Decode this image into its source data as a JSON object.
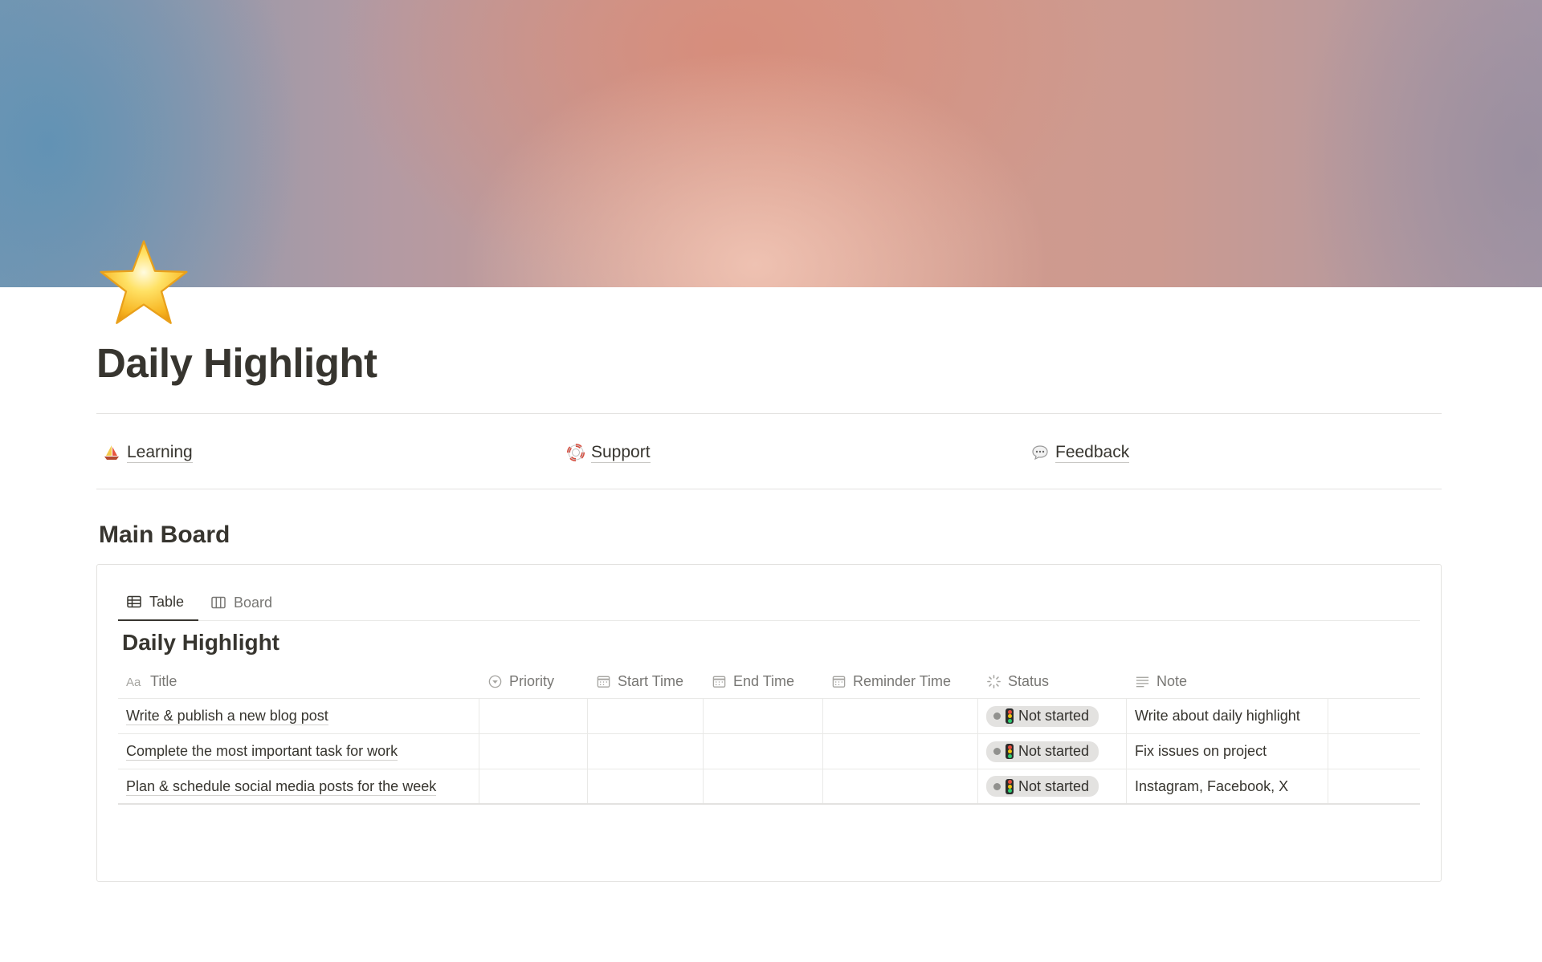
{
  "page": {
    "icon": "star-icon",
    "title": "Daily Highlight"
  },
  "links": [
    {
      "icon": "sailboat-icon",
      "label": "Learning"
    },
    {
      "icon": "life-ring-icon",
      "label": "Support"
    },
    {
      "icon": "speech-bubble-icon",
      "label": "Feedback"
    }
  ],
  "section": {
    "title": "Main Board"
  },
  "database": {
    "tabs": [
      {
        "icon": "table-icon",
        "label": "Table",
        "active": true
      },
      {
        "icon": "board-icon",
        "label": "Board",
        "active": false
      }
    ],
    "title": "Daily Highlight",
    "columns": [
      {
        "icon": "text-aa-icon",
        "label": "Title"
      },
      {
        "icon": "select-icon",
        "label": "Priority"
      },
      {
        "icon": "calendar-icon",
        "label": "Start Time"
      },
      {
        "icon": "calendar-icon",
        "label": "End Time"
      },
      {
        "icon": "calendar-icon",
        "label": "Reminder Time"
      },
      {
        "icon": "status-spinner-icon",
        "label": "Status"
      },
      {
        "icon": "text-lines-icon",
        "label": "Note"
      }
    ],
    "rows": [
      {
        "title": "Write & publish a new blog post",
        "priority": "",
        "start": "",
        "end": "",
        "reminder": "",
        "status": "Not started",
        "note": "Write about daily highlight"
      },
      {
        "title": "Complete the most important task for work",
        "priority": "",
        "start": "",
        "end": "",
        "reminder": "",
        "status": "Not started",
        "note": "Fix issues on project"
      },
      {
        "title": "Plan & schedule social media posts for the week",
        "priority": "",
        "start": "",
        "end": "",
        "reminder": "",
        "status": "Not started",
        "note": "Instagram, Facebook, X"
      }
    ]
  },
  "colors": {
    "text": "#37352f",
    "muted": "#787774",
    "status_pill_bg": "#e3e2e0",
    "status_dot": "#91918e"
  }
}
